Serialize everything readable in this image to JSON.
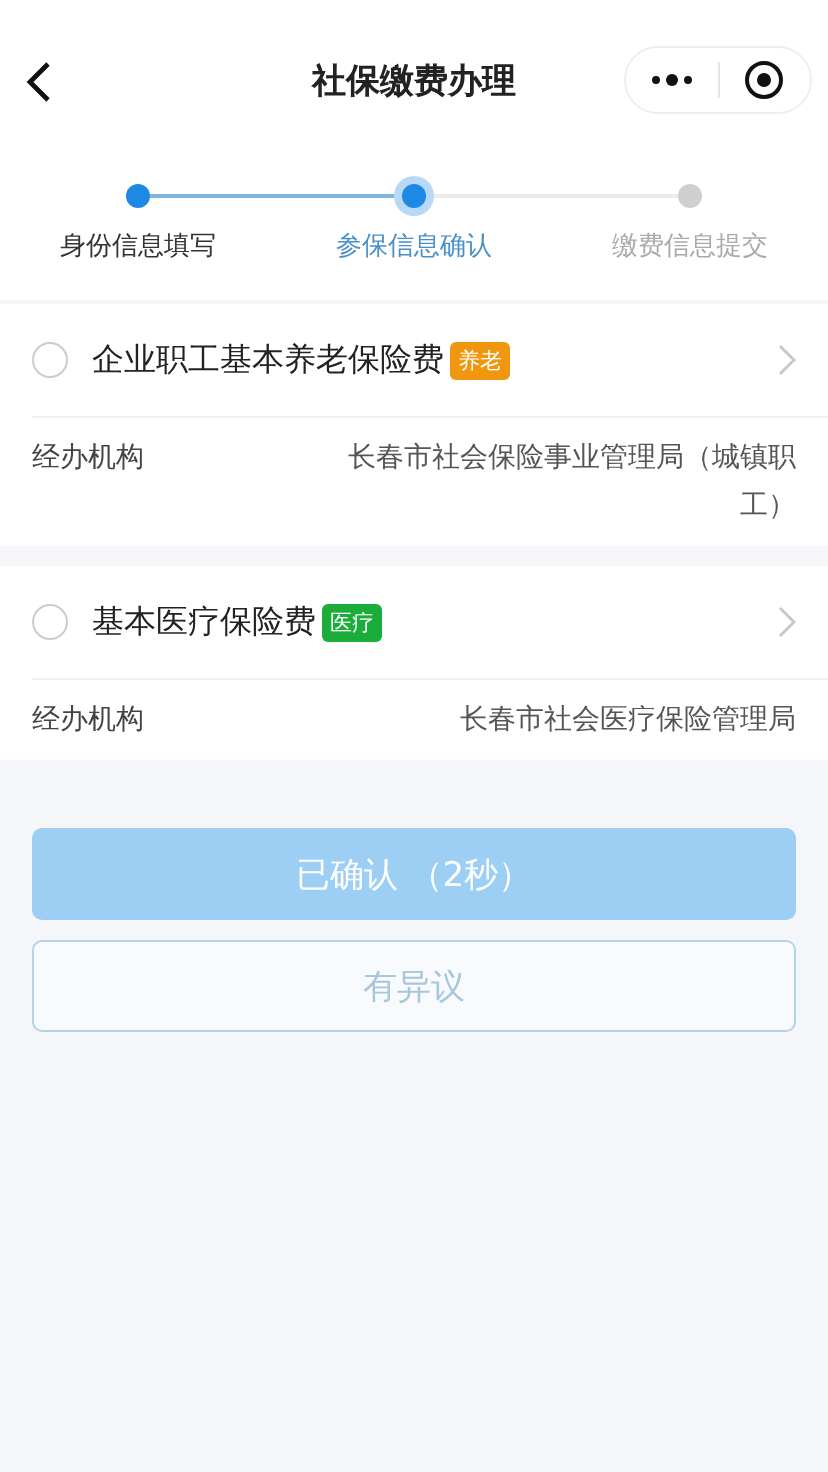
{
  "nav": {
    "title": "社保缴费办理"
  },
  "steps": [
    {
      "label": "身份信息填写",
      "done": true,
      "selected": false
    },
    {
      "label": "参保信息确认",
      "done": true,
      "selected": true
    },
    {
      "label": "缴费信息提交",
      "done": false,
      "selected": false
    }
  ],
  "items": [
    {
      "name": "企业职工基本养老保险费",
      "badge": "养老",
      "color": "#f0960f",
      "checked": false,
      "field_label": "经办机构",
      "field_value": "长春市社会保险事业管理局（城镇职工）"
    },
    {
      "name": "基本医疗保险费",
      "badge": "医疗",
      "color": "#1aad3a",
      "checked": false,
      "field_label": "经办机构",
      "field_value": "长春市社会医疗保险管理局"
    }
  ],
  "buttons": [
    {
      "label": "已确认 （2秒）",
      "kind": "primary",
      "disabled": true
    },
    {
      "label": "有异议",
      "kind": "outline",
      "disabled": true
    }
  ]
}
